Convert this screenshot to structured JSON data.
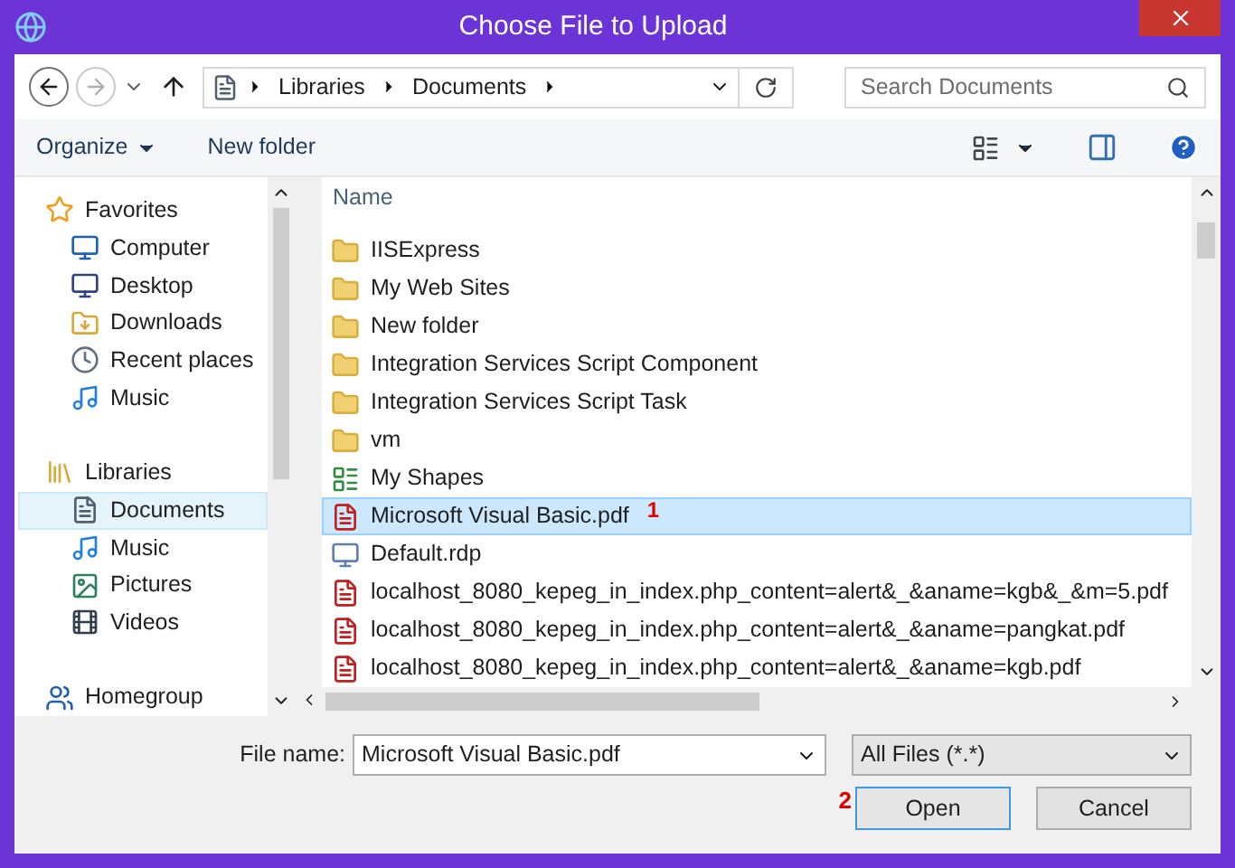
{
  "window": {
    "title": "Choose File to Upload"
  },
  "address": {
    "crumbs": [
      "Libraries",
      "Documents"
    ],
    "search_placeholder": "Search Documents"
  },
  "toolbar": {
    "organize": "Organize",
    "new_folder": "New folder"
  },
  "nav": [
    {
      "kind": "header",
      "label": "Favorites",
      "selected": false
    },
    {
      "kind": "item",
      "label": "Computer",
      "selected": false
    },
    {
      "kind": "item",
      "label": "Desktop",
      "selected": false
    },
    {
      "kind": "item",
      "label": "Downloads",
      "selected": false
    },
    {
      "kind": "item",
      "label": "Recent places",
      "selected": false
    },
    {
      "kind": "item",
      "label": "Music",
      "selected": false
    },
    {
      "kind": "gap"
    },
    {
      "kind": "header",
      "label": "Libraries",
      "selected": false
    },
    {
      "kind": "item",
      "label": "Documents",
      "selected": true
    },
    {
      "kind": "item",
      "label": "Music",
      "selected": false
    },
    {
      "kind": "item",
      "label": "Pictures",
      "selected": false
    },
    {
      "kind": "item",
      "label": "Videos",
      "selected": false
    },
    {
      "kind": "gap"
    },
    {
      "kind": "header",
      "label": "Homegroup",
      "selected": false
    }
  ],
  "files": {
    "column": "Name",
    "rows": [
      {
        "kind": "folder",
        "name": "IISExpress",
        "selected": false
      },
      {
        "kind": "folder",
        "name": "My Web Sites",
        "selected": false
      },
      {
        "kind": "folder",
        "name": "New folder",
        "selected": false
      },
      {
        "kind": "folder",
        "name": "Integration Services Script Component",
        "selected": false
      },
      {
        "kind": "folder",
        "name": "Integration Services Script Task",
        "selected": false
      },
      {
        "kind": "folder",
        "name": "vm",
        "selected": false
      },
      {
        "kind": "shapes",
        "name": "My Shapes",
        "selected": false
      },
      {
        "kind": "pdf",
        "name": "Microsoft Visual Basic.pdf",
        "selected": true,
        "annotation": "1"
      },
      {
        "kind": "rdp",
        "name": "Default.rdp",
        "selected": false
      },
      {
        "kind": "pdf",
        "name": "localhost_8080_kepeg_in_index.php_content=alert&_&aname=kgb&_&m=5.pdf",
        "selected": false
      },
      {
        "kind": "pdf",
        "name": "localhost_8080_kepeg_in_index.php_content=alert&_&aname=pangkat.pdf",
        "selected": false
      },
      {
        "kind": "pdf",
        "name": "localhost_8080_kepeg_in_index.php_content=alert&_&aname=kgb.pdf",
        "selected": false
      }
    ]
  },
  "footer": {
    "file_name_label": "File name:",
    "file_name": "Microsoft Visual Basic.pdf",
    "file_type": "All Files (*.*)",
    "open": "Open",
    "open_annotation": "2",
    "cancel": "Cancel"
  }
}
